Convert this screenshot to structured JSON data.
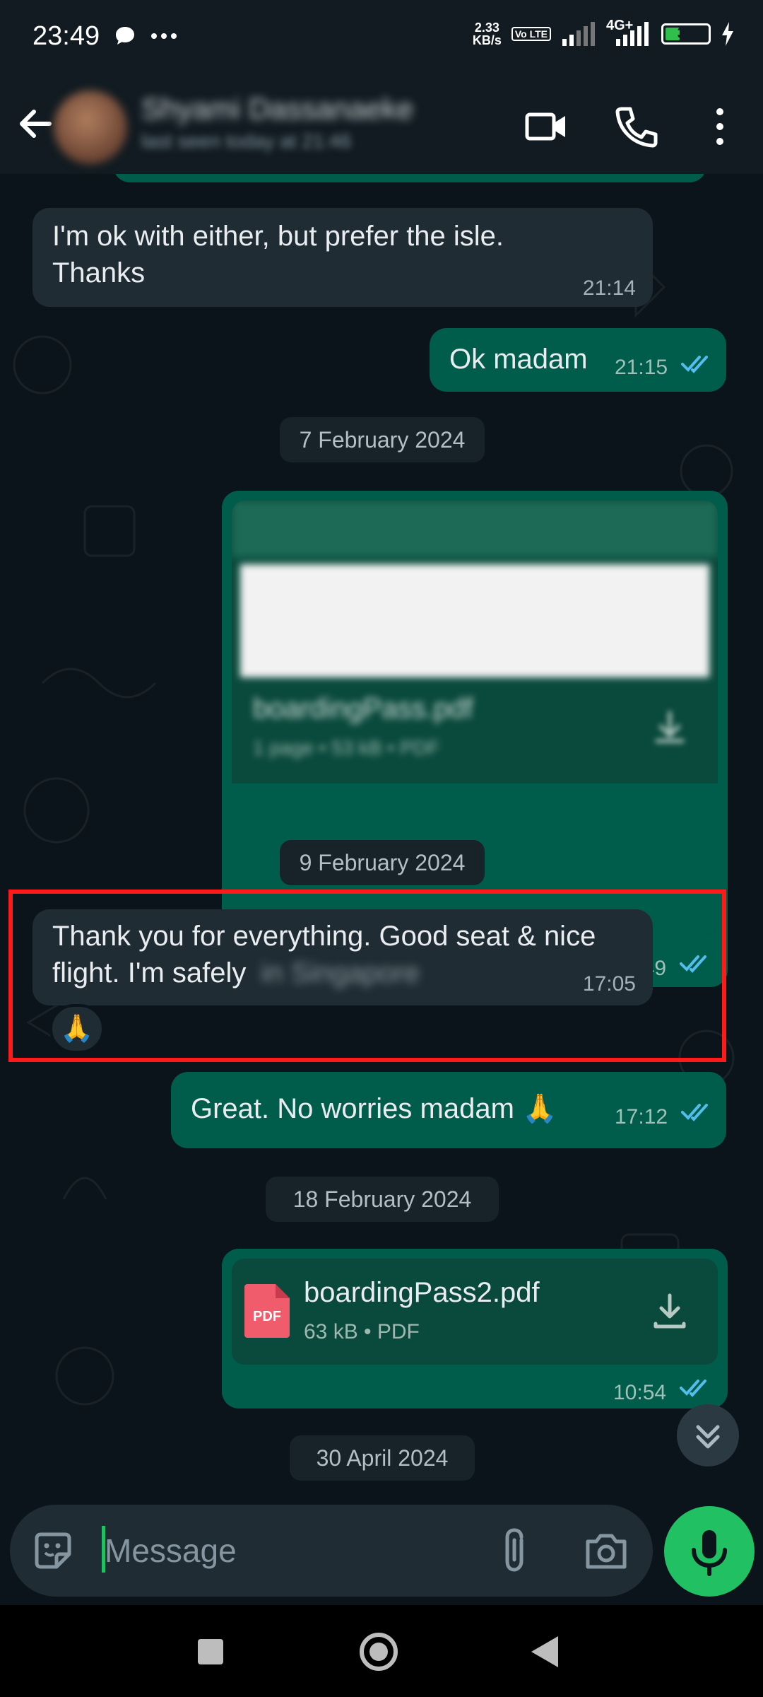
{
  "status_bar": {
    "time": "23:49",
    "net_speed_value": "2.33",
    "net_speed_unit": "KB/s",
    "volte": "Vo LTE",
    "network": "4G+",
    "battery": "31",
    "battery_fraction": 0.31
  },
  "header": {
    "contact_name": "Shyami Dassanaeke",
    "last_seen": "last seen today at 21:46"
  },
  "messages": [
    {
      "text": "I'm ok with either, but prefer the isle. Thanks",
      "time": "21:14"
    },
    {
      "text": "Ok madam",
      "time": "21:15"
    },
    {
      "date": "7 February 2024"
    },
    {
      "time": "10:49",
      "doc_name": "boardingPass.pdf",
      "doc_meta": "1 page • 53 kB • PDF"
    },
    {
      "date": "9 February 2024"
    },
    {
      "text": "Thank you for everything. Good seat & nice flight. I'm safely",
      "hidden_text": "in Singapore",
      "time": "17:05",
      "reaction": "🙏"
    },
    {
      "text": "Great. No worries madam 🙏",
      "time": "17:12"
    },
    {
      "date": "18 February 2024"
    },
    {
      "doc_name": "boardingPass2.pdf",
      "doc_meta": "63 kB • PDF",
      "doc_badge": "PDF",
      "time": "10:54"
    },
    {
      "date": "30 April 2024"
    }
  ],
  "input": {
    "placeholder": "Message"
  },
  "colors": {
    "incoming_bubble": "#202c33",
    "outgoing_bubble": "#005c4b",
    "accent": "#21c063",
    "read_ticks": "#53bdeb",
    "highlight": "#ff1a1a"
  }
}
